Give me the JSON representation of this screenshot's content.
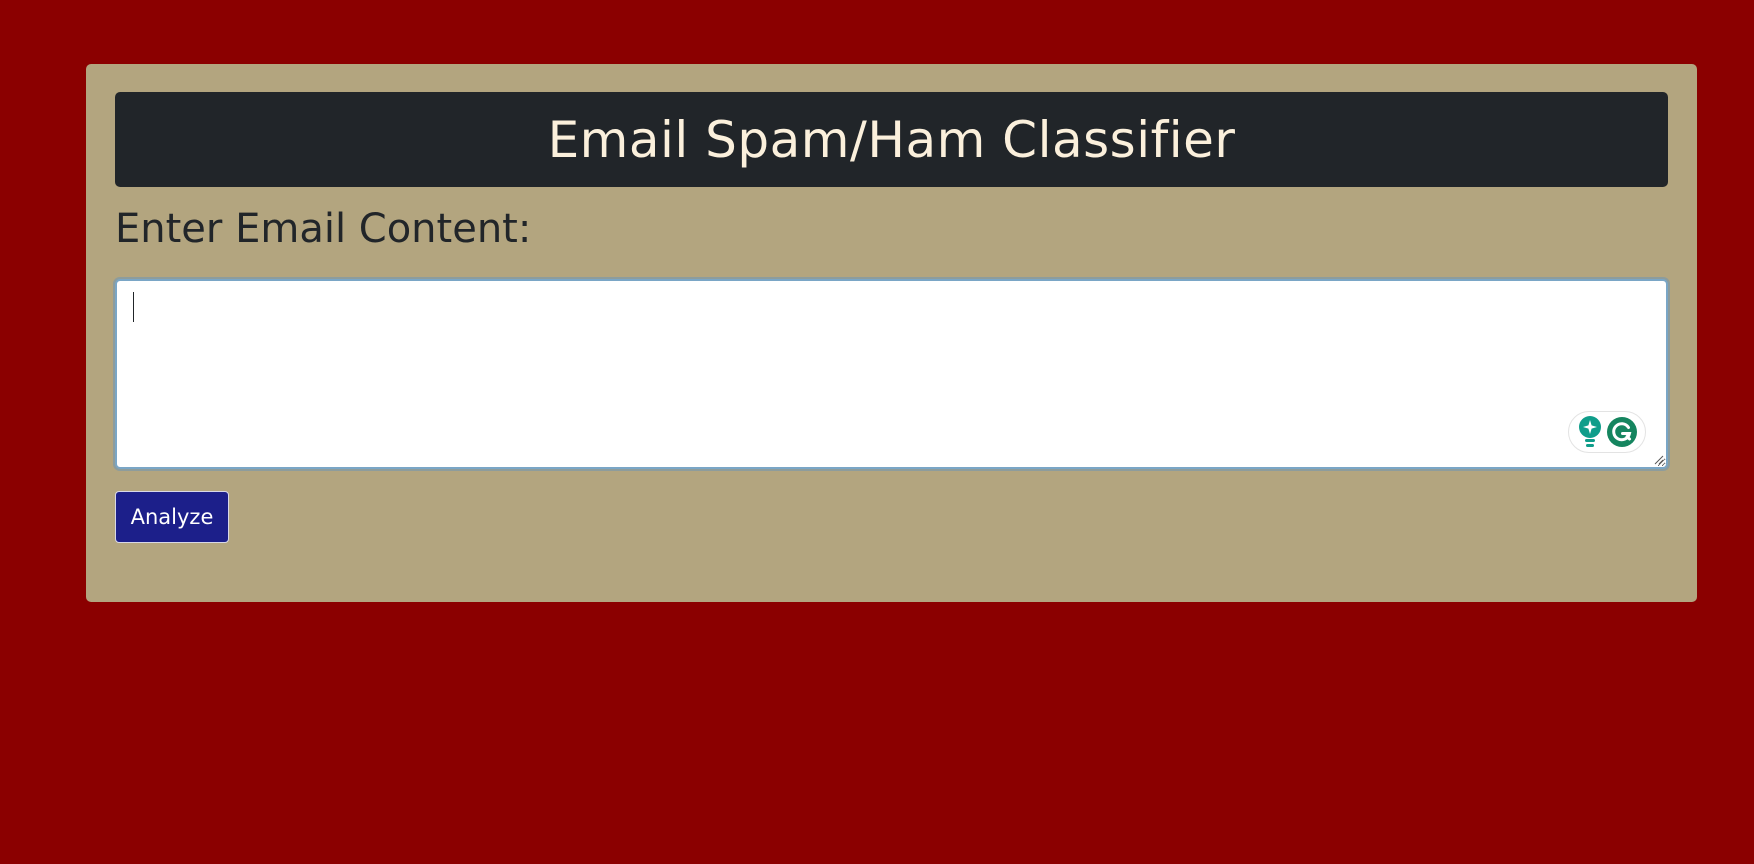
{
  "page": {
    "background_color": "#8b0000",
    "card_color": "#b3a57f"
  },
  "header": {
    "title": "Email Spam/Ham Classifier",
    "background_color": "#212529",
    "text_color": "#fbf0dc"
  },
  "form": {
    "label": "Enter Email Content:",
    "textarea": {
      "value": "",
      "placeholder": ""
    },
    "submit_label": "Analyze",
    "submit_color": "#1c1f8a"
  },
  "widgets": {
    "assist_icons": [
      "lightbulb-icon",
      "grammarly-g-icon"
    ],
    "accent_color": "#0f9d8a"
  }
}
